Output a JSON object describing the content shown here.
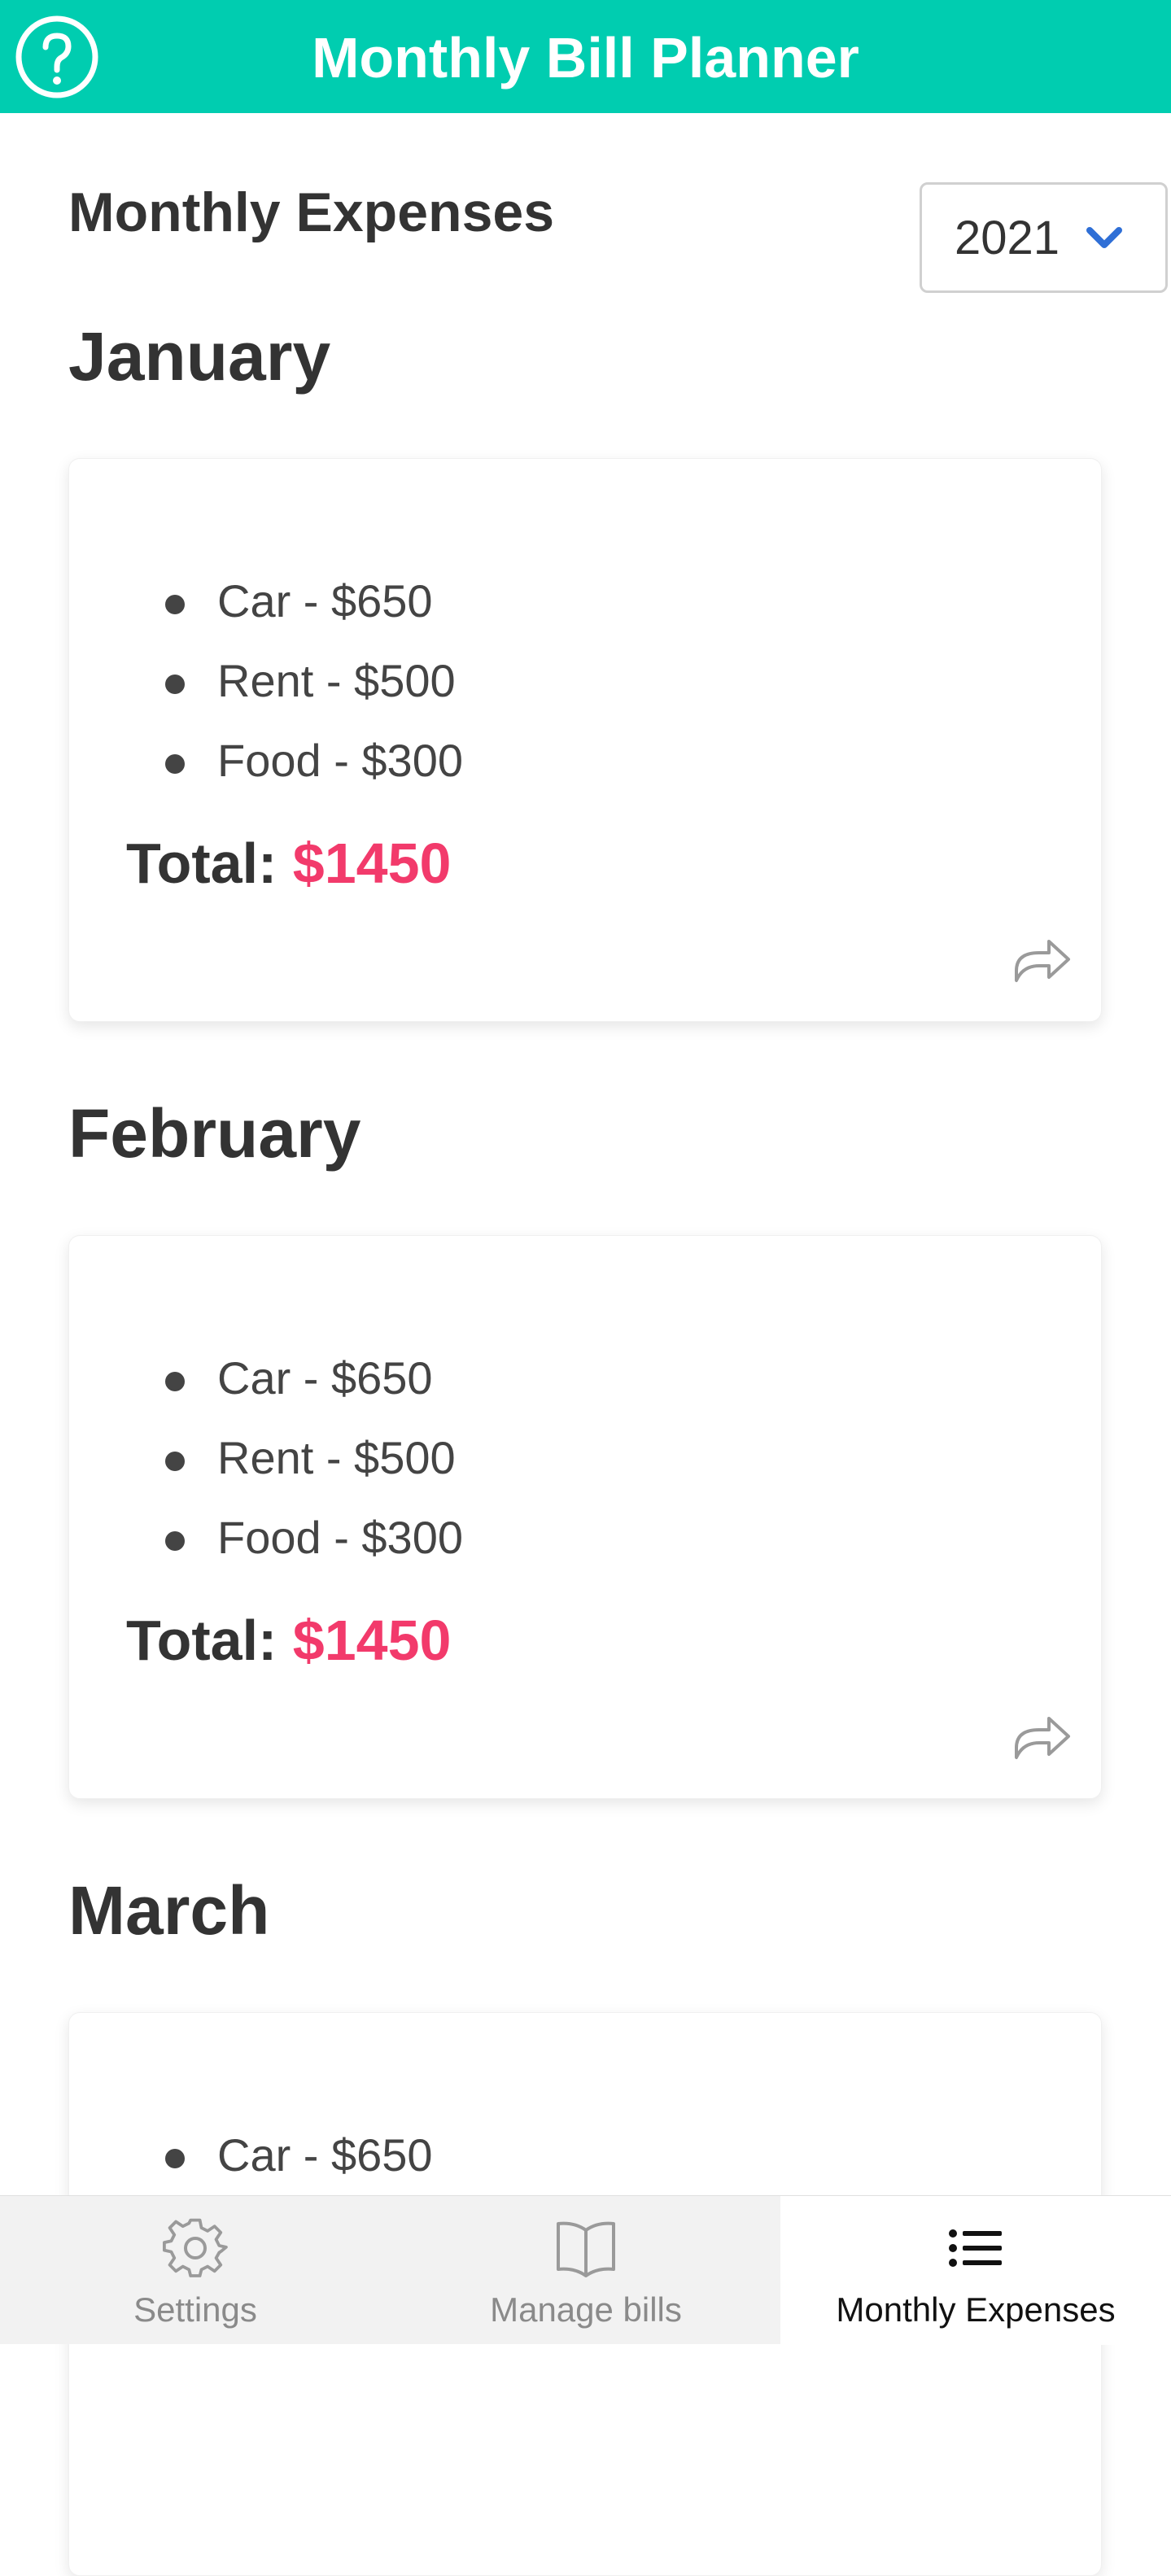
{
  "header": {
    "title": "Monthly Bill Planner",
    "help_icon": "question-circle-icon",
    "background": "#00CDB0"
  },
  "page": {
    "heading": "Monthly Expenses",
    "year_select": {
      "value": "2021",
      "icon": "chevron-down-icon"
    }
  },
  "months": [
    {
      "name": "January",
      "items": [
        "Car - $650",
        "Rent - $500",
        "Food - $300"
      ],
      "total_label": "Total:",
      "total_value": "$1450"
    },
    {
      "name": "February",
      "items": [
        "Car - $650",
        "Rent - $500",
        "Food - $300"
      ],
      "total_label": "Total:",
      "total_value": "$1450"
    },
    {
      "name": "March",
      "items": [
        "Car - $650"
      ]
    }
  ],
  "tabs": [
    {
      "label": "Settings",
      "icon": "gear-icon",
      "active": false
    },
    {
      "label": "Manage bills",
      "icon": "book-icon",
      "active": false
    },
    {
      "label": "Monthly Expenses",
      "icon": "list-icon",
      "active": true
    }
  ],
  "colors": {
    "accent": "#00CDB0",
    "total_amount": "#F23A6B",
    "chevron": "#2F6FD6"
  }
}
